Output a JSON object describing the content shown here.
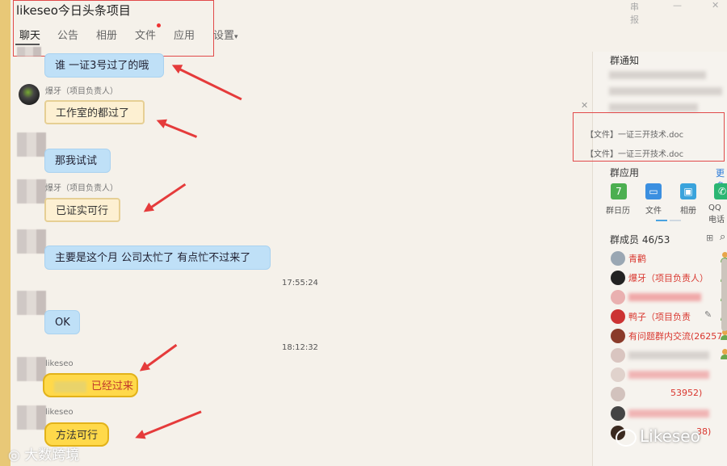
{
  "window": {
    "title": "likeseo今日头条项目",
    "controls": [
      "串报",
      "—",
      "✕"
    ]
  },
  "tabs": [
    {
      "label": "聊天",
      "active": true
    },
    {
      "label": "公告",
      "active": false
    },
    {
      "label": "相册",
      "active": false
    },
    {
      "label": "文件",
      "active": false,
      "badge": true
    },
    {
      "label": "应用",
      "active": false
    },
    {
      "label": "设置",
      "active": false,
      "dropdown": "▾"
    }
  ],
  "messages": [
    {
      "sender": "",
      "text": "谁 一证3号过了的哦",
      "style": "blue"
    },
    {
      "sender": "爆牙（项目负责人）",
      "text": "工作室的都过了",
      "style": "scroll"
    },
    {
      "sender": "",
      "text": "那我试试",
      "style": "blue"
    },
    {
      "sender": "爆牙（项目负责人）",
      "text": "已证实可行",
      "style": "scroll"
    },
    {
      "sender": "",
      "text": "主要是这个月 公司太忙了 有点忙不过来了",
      "style": "blue"
    },
    {
      "timestamp": "17:55:24"
    },
    {
      "sender": "",
      "text": "OK",
      "style": "blue"
    },
    {
      "timestamp": "18:12:32"
    },
    {
      "sender": "likeseo",
      "text": "已经过来",
      "style": "yellow"
    },
    {
      "sender": "likeseo",
      "text": "方法可行",
      "style": "yellow"
    }
  ],
  "right_panel": {
    "notice_header": "群通知",
    "files": [
      "【文件】一证三开技术.doc",
      "【文件】一证三开技术.doc"
    ],
    "apps_header": "群应用",
    "apps_more": "更多",
    "apps": [
      {
        "label": "群日历",
        "icon": "calendar-icon",
        "color": "#4caf50",
        "glyph": "7"
      },
      {
        "label": "文件",
        "icon": "folder-icon",
        "color": "#3b8fe0",
        "glyph": "▭"
      },
      {
        "label": "相册",
        "icon": "photo-icon",
        "color": "#3aa3dc",
        "glyph": "▣"
      },
      {
        "label": "QQ电话",
        "icon": "phone-icon",
        "color": "#2bb673",
        "glyph": "✆"
      }
    ],
    "members_header": "群成员 46/53",
    "members": [
      {
        "name": "青鹳",
        "avatar_color": "#9aa7b3"
      },
      {
        "name": "爆牙（项目负责人）",
        "avatar_color": "#222"
      },
      {
        "name": "",
        "avatar_color": "#e9b0b0"
      },
      {
        "name": "鸭子（项目负责",
        "avatar_color": "#c33"
      },
      {
        "name": "有问题群内交流(26257",
        "avatar_color": "#8a3b2a"
      },
      {
        "name": "",
        "avatar_color": "#d9c5c0"
      },
      {
        "name": "",
        "avatar_color": "#e0d2cc"
      },
      {
        "name": "53952)",
        "avatar_color": "#d2c2bd"
      },
      {
        "name": "",
        "avatar_color": "#444"
      },
      {
        "name": "38)",
        "avatar_color": "#3b2a20"
      }
    ]
  },
  "watermarks": {
    "left": "大数跨境",
    "right": "Likeseo"
  }
}
